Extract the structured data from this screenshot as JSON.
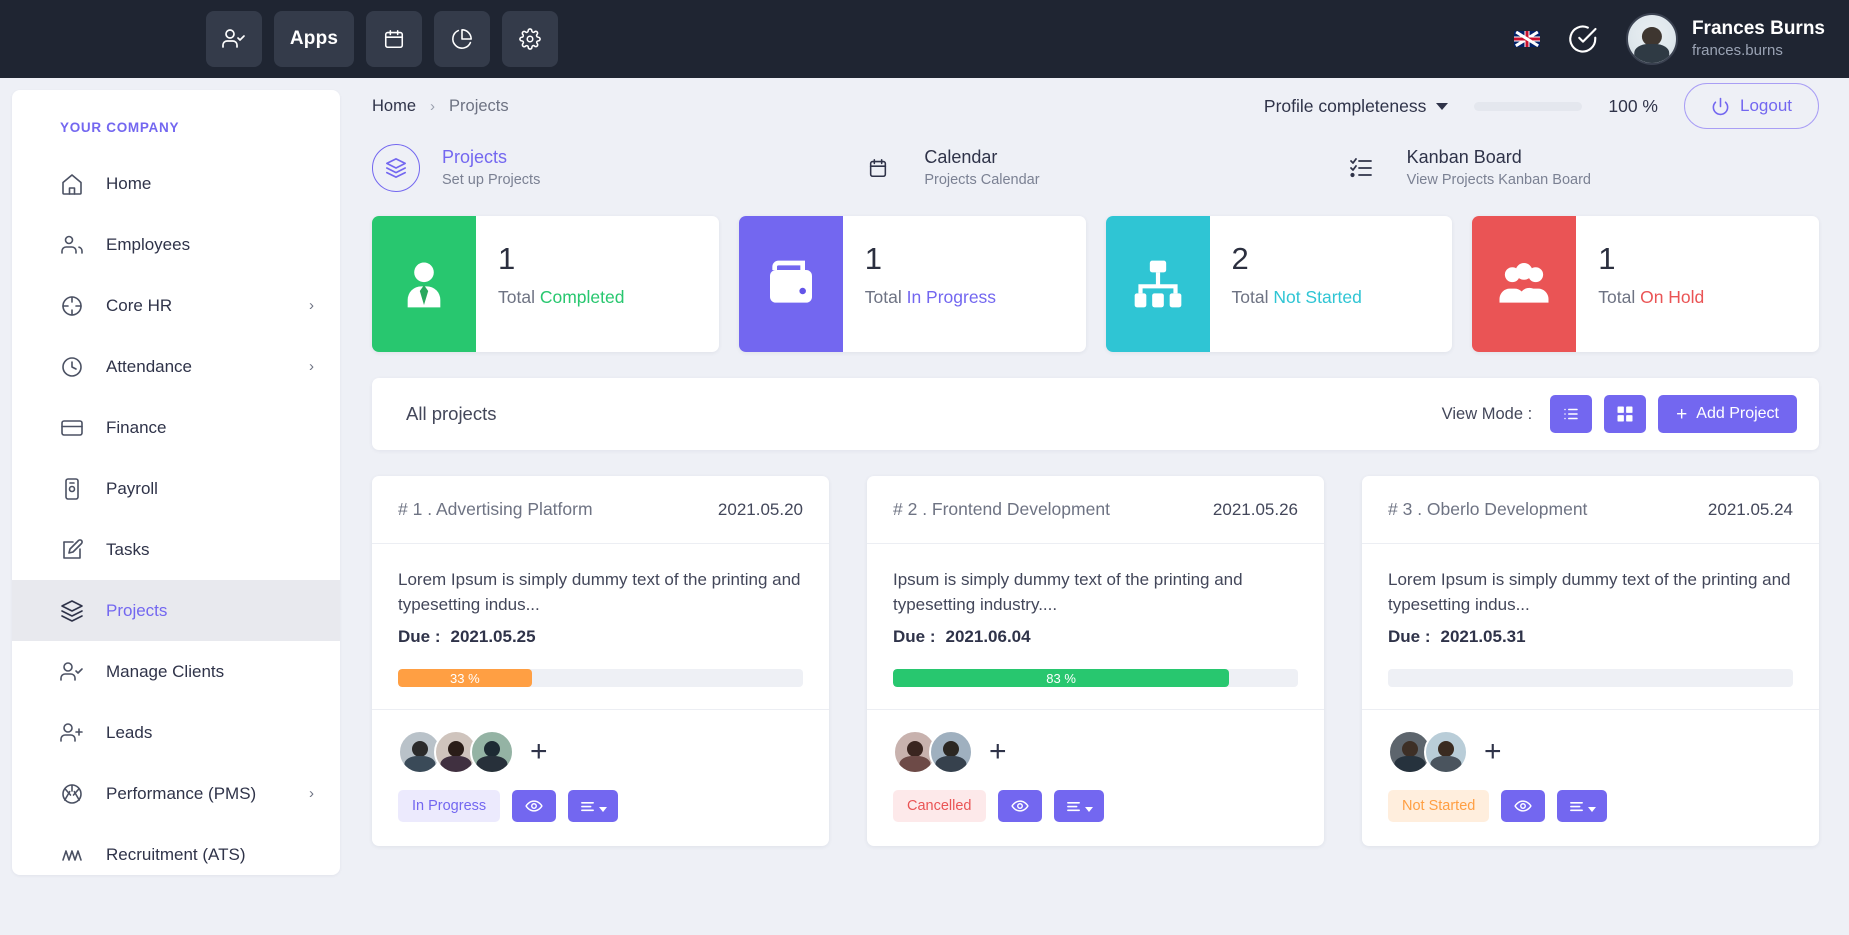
{
  "topbar": {
    "nav": [
      {
        "name": "user-check-icon",
        "label": ""
      },
      {
        "name": "apps-button",
        "label": "Apps"
      },
      {
        "name": "calendar-icon",
        "label": ""
      },
      {
        "name": "chart-pie-icon",
        "label": ""
      },
      {
        "name": "gear-icon",
        "label": ""
      }
    ],
    "apps_label": "Apps",
    "language_flag": "uk-flag-icon",
    "check_icon": "check-circle-icon",
    "user_name": "Frances Burns",
    "user_handle": "frances.burns"
  },
  "sidebar": {
    "heading": "YOUR COMPANY",
    "items": [
      {
        "label": "Home",
        "icon": "home-icon",
        "chevron": false,
        "active": false
      },
      {
        "label": "Employees",
        "icon": "users-icon",
        "chevron": false,
        "active": false
      },
      {
        "label": "Core HR",
        "icon": "compass-icon",
        "chevron": true,
        "active": false
      },
      {
        "label": "Attendance",
        "icon": "clock-icon",
        "chevron": true,
        "active": false
      },
      {
        "label": "Finance",
        "icon": "credit-card-icon",
        "chevron": false,
        "active": false
      },
      {
        "label": "Payroll",
        "icon": "payroll-icon",
        "chevron": false,
        "active": false
      },
      {
        "label": "Tasks",
        "icon": "edit-square-icon",
        "chevron": false,
        "active": false
      },
      {
        "label": "Projects",
        "icon": "layers-icon",
        "chevron": false,
        "active": true
      },
      {
        "label": "Manage Clients",
        "icon": "user-check-icon",
        "chevron": false,
        "active": false
      },
      {
        "label": "Leads",
        "icon": "user-plus-icon",
        "chevron": false,
        "active": false
      },
      {
        "label": "Performance (PMS)",
        "icon": "aperture-icon",
        "chevron": true,
        "active": false
      },
      {
        "label": "Recruitment (ATS)",
        "icon": "activity-icon",
        "chevron": false,
        "active": false
      }
    ]
  },
  "breadcrumb": {
    "home": "Home",
    "separator": "›",
    "current": "Projects"
  },
  "profile_completeness": {
    "label": "Profile completeness",
    "percent_text": "100 %",
    "percent_value": 100,
    "bar_color": "#28c76f"
  },
  "logout": {
    "label": "Logout",
    "icon": "power-icon"
  },
  "nav_tiles": [
    {
      "title": "Projects",
      "subtitle": "Set up Projects",
      "icon": "layers-icon",
      "active": true
    },
    {
      "title": "Calendar",
      "subtitle": "Projects Calendar",
      "icon": "calendar-icon",
      "active": false
    },
    {
      "title": "Kanban Board",
      "subtitle": "View Projects Kanban Board",
      "icon": "checklist-icon",
      "active": false
    }
  ],
  "stats": [
    {
      "count": "1",
      "prefix": "Total ",
      "status": "Completed",
      "color": "#28c76f",
      "icon": "employee-tie-icon"
    },
    {
      "count": "1",
      "prefix": "Total ",
      "status": "In Progress",
      "color": "#7367f0",
      "icon": "wallet-icon"
    },
    {
      "count": "2",
      "prefix": "Total ",
      "status": "Not Started",
      "color": "#2fc5d4",
      "icon": "sitemap-icon"
    },
    {
      "count": "1",
      "prefix": "Total ",
      "status": "On Hold",
      "color": "#ea5455",
      "icon": "people-group-icon"
    }
  ],
  "projects_bar": {
    "title": "All projects",
    "view_mode_label": "View Mode :",
    "list_view_icon": "list-view-icon",
    "grid_view_icon": "grid-view-icon",
    "add_project_label": "Add Project",
    "add_icon": "plus-icon",
    "accent": "#7367f0"
  },
  "project_cards": [
    {
      "title": "# 1 . Advertising Platform",
      "date": "2021.05.20",
      "description": "Lorem Ipsum is simply dummy text of the printing and typesetting indus...",
      "due_label": "Due :",
      "due_date": "2021.05.25",
      "progress_text": "33 %",
      "progress_value": 33,
      "progress_color": "#ff9f43",
      "status": "In Progress",
      "status_color": "#7367f0",
      "status_bg": "#eceafd",
      "avatars": [
        "#b9c2c9|#2b2b2b|#3a4a58",
        "#cfc4bd|#2a1d18|#403040",
        "#94b3a4|#1d2a33|#27303a"
      ],
      "add_member": "+",
      "view_icon": "eye-icon",
      "menu_icon": "menu-caret-icon"
    },
    {
      "title": "# 2 . Frontend Development",
      "date": "2021.05.26",
      "description": "Ipsum is simply dummy text of the printing and typesetting industry....",
      "due_label": "Due :",
      "due_date": "2021.06.04",
      "progress_text": "83 %",
      "progress_value": 83,
      "progress_color": "#28c76f",
      "status": "Cancelled",
      "status_color": "#ea5455",
      "status_bg": "#fde9ea",
      "avatars": [
        "#c8b2ae|#3a2520|#6d4a47",
        "#9fb0bf|#2b2722|#36414d"
      ],
      "add_member": "+",
      "view_icon": "eye-icon",
      "menu_icon": "menu-caret-icon"
    },
    {
      "title": "# 3 . Oberlo Development",
      "date": "2021.05.24",
      "description": "Lorem Ipsum is simply dummy text of the printing and typesetting indus...",
      "due_label": "Due :",
      "due_date": "2021.05.31",
      "progress_text": "",
      "progress_value": 0,
      "progress_color": "#eef0f5",
      "status": "Not Started",
      "status_color": "#ff9f43",
      "status_bg": "#ffeedd",
      "avatars": [
        "#5d656d|#3d2f26|#26323d",
        "#b9cdd8|#3a2b21|#4a545e"
      ],
      "add_member": "+",
      "view_icon": "eye-icon",
      "menu_icon": "menu-caret-icon"
    }
  ]
}
